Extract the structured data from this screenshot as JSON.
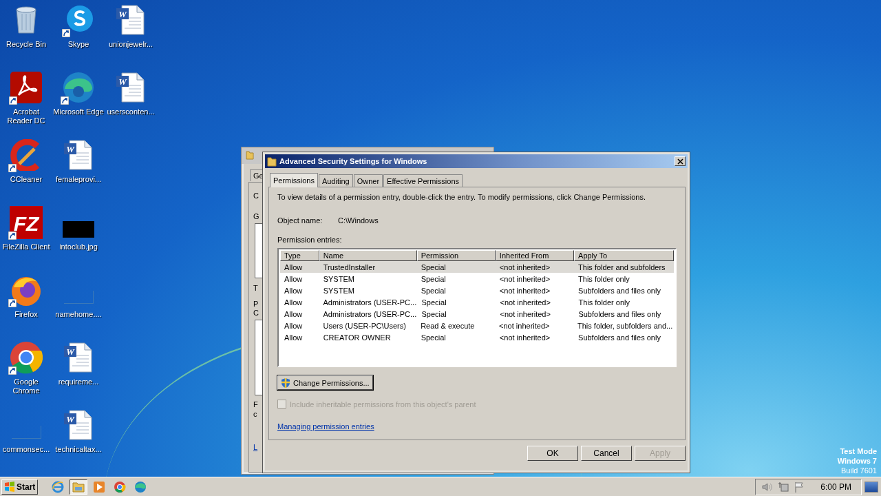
{
  "desktop": {
    "columns": [
      [
        {
          "label": "Recycle Bin",
          "kind": "recycle",
          "shortcut": false
        },
        {
          "label": "Acrobat Reader DC",
          "kind": "acrobat",
          "shortcut": true
        },
        {
          "label": "CCleaner",
          "kind": "ccleaner",
          "shortcut": true
        },
        {
          "label": "FileZilla Client",
          "kind": "filezilla",
          "shortcut": true,
          "logo_text": "FZ"
        },
        {
          "label": "Firefox",
          "kind": "firefox",
          "shortcut": true
        },
        {
          "label": "Google Chrome",
          "kind": "chrome",
          "shortcut": true
        },
        {
          "label": "commonsec...",
          "kind": "blank",
          "shortcut": false
        }
      ],
      [
        {
          "label": "Skype",
          "kind": "skype",
          "shortcut": true
        },
        {
          "label": "Microsoft Edge",
          "kind": "edge",
          "shortcut": true
        },
        {
          "label": "femaleprovi...",
          "kind": "word",
          "shortcut": false,
          "logo_text": "W"
        },
        {
          "label": "intoclub.jpg",
          "kind": "image",
          "shortcut": false
        },
        {
          "label": "namehome....",
          "kind": "blank",
          "shortcut": false
        },
        {
          "label": "requireme...",
          "kind": "word",
          "shortcut": false,
          "logo_text": "W"
        },
        {
          "label": "technicaltax...",
          "kind": "word",
          "shortcut": false,
          "logo_text": "W"
        }
      ],
      [
        {
          "label": "unionjewelr...",
          "kind": "word",
          "shortcut": false,
          "logo_text": "W"
        },
        {
          "label": "usersconten...",
          "kind": "word",
          "shortcut": false,
          "logo_text": "W"
        }
      ]
    ]
  },
  "back_window": {
    "tab": "Ge",
    "fragments": [
      "C",
      "G",
      "T",
      "P",
      "C",
      "F",
      "c",
      "L"
    ]
  },
  "dialog": {
    "title": "Advanced Security Settings for Windows",
    "tabs": [
      {
        "label": "Permissions",
        "selected": true
      },
      {
        "label": "Auditing",
        "selected": false
      },
      {
        "label": "Owner",
        "selected": false
      },
      {
        "label": "Effective Permissions",
        "selected": false
      }
    ],
    "instructions": "To view details of a permission entry, double-click the entry. To modify permissions, click Change Permissions.",
    "object_name_label": "Object name:",
    "object_name": "C:\\Windows",
    "entries_label": "Permission entries:",
    "table": {
      "columns": [
        "Type",
        "Name",
        "Permission",
        "Inherited From",
        "Apply To"
      ],
      "rows": [
        {
          "cells": [
            "Allow",
            "TrustedInstaller",
            "Special",
            "<not inherited>",
            "This folder and subfolders"
          ],
          "selected": true
        },
        {
          "cells": [
            "Allow",
            "SYSTEM",
            "Special",
            "<not inherited>",
            "This folder only"
          ],
          "selected": false
        },
        {
          "cells": [
            "Allow",
            "SYSTEM",
            "Special",
            "<not inherited>",
            "Subfolders and files only"
          ],
          "selected": false
        },
        {
          "cells": [
            "Allow",
            "Administrators (USER-PC...",
            "Special",
            "<not inherited>",
            "This folder only"
          ],
          "selected": false
        },
        {
          "cells": [
            "Allow",
            "Administrators (USER-PC...",
            "Special",
            "<not inherited>",
            "Subfolders and files only"
          ],
          "selected": false
        },
        {
          "cells": [
            "Allow",
            "Users (USER-PC\\Users)",
            "Read & execute",
            "<not inherited>",
            "This folder, subfolders and..."
          ],
          "selected": false
        },
        {
          "cells": [
            "Allow",
            "CREATOR OWNER",
            "Special",
            "<not inherited>",
            "Subfolders and files only"
          ],
          "selected": false
        }
      ]
    },
    "change_button": "Change Permissions...",
    "inherit_checkbox": {
      "label": "Include inheritable permissions from this object's parent",
      "checked": false,
      "disabled": true
    },
    "link": "Managing permission entries",
    "buttons": [
      {
        "label": "OK",
        "disabled": false
      },
      {
        "label": "Cancel",
        "disabled": false
      },
      {
        "label": "Apply",
        "disabled": true
      }
    ]
  },
  "test_mode": [
    "Test Mode",
    "Windows 7",
    "Build 7601"
  ],
  "taskbar": {
    "start": "Start",
    "apps": [
      {
        "kind": "ie",
        "selected": false
      },
      {
        "kind": "explorer",
        "selected": true
      },
      {
        "kind": "media",
        "selected": false
      },
      {
        "kind": "chrome",
        "selected": false
      },
      {
        "kind": "edge",
        "selected": false
      }
    ],
    "clock": "6:00 PM"
  }
}
